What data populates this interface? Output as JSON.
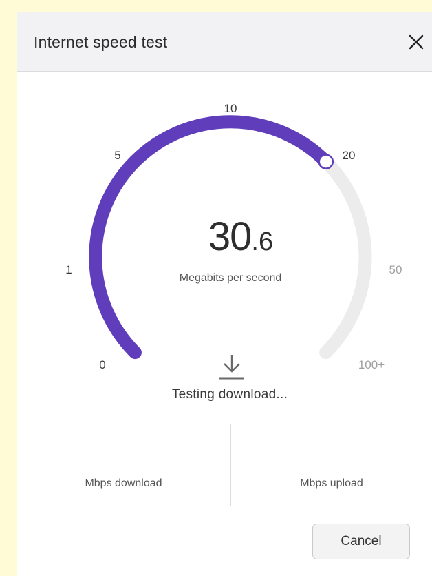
{
  "dialog": {
    "title": "Internet speed test",
    "close_icon": "close-icon"
  },
  "gauge": {
    "ticks": [
      "0",
      "1",
      "5",
      "10",
      "20",
      "50",
      "100+"
    ],
    "reading_whole": "30",
    "reading_decimal": ".6",
    "unit": "Megabits per second",
    "progress_fraction": 0.667,
    "colors": {
      "progress": "#5f3dbb",
      "track": "#ececec",
      "tick_active": "#3a3a3a",
      "tick_inactive": "#a0a0a0"
    }
  },
  "status": {
    "icon": "download-arrow-icon",
    "text": "Testing download..."
  },
  "results": {
    "download_label": "Mbps download",
    "upload_label": "Mbps upload"
  },
  "actions": {
    "cancel_label": "Cancel"
  }
}
